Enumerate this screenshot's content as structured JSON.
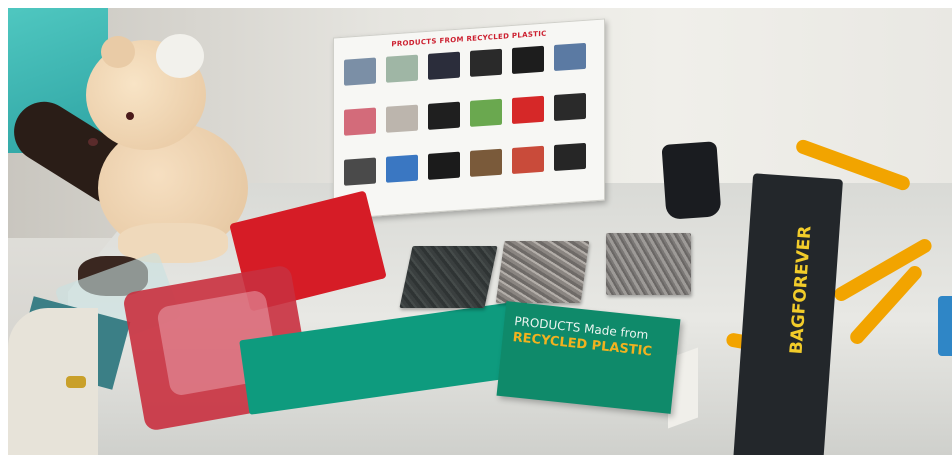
{
  "scene": {
    "subject": "Exhibition table of products made from recycled plastic",
    "poster": {
      "title": "PRODUCTS FROM RECYCLED PLASTIC",
      "items": [
        {
          "label": "",
          "color": "#7b8fa6"
        },
        {
          "label": "",
          "color": "#9fb6a5"
        },
        {
          "label": "",
          "color": "#2b2d3b"
        },
        {
          "label": "",
          "color": "#2a2a2a"
        },
        {
          "label": "",
          "color": "#1d1d1d"
        },
        {
          "label": "",
          "color": "#5b7aa3"
        },
        {
          "label": "",
          "color": "#d36b7a"
        },
        {
          "label": "",
          "color": "#bcb5ad"
        },
        {
          "label": "",
          "color": "#1f1f1f"
        },
        {
          "label": "",
          "color": "#6aa84f"
        },
        {
          "label": "",
          "color": "#d62828"
        },
        {
          "label": "",
          "color": "#2a2a2a"
        },
        {
          "label": "",
          "color": "#4a4a4a"
        },
        {
          "label": "",
          "color": "#3a77c2"
        },
        {
          "label": "",
          "color": "#1b1b1b"
        },
        {
          "label": "",
          "color": "#7a5a3a"
        },
        {
          "label": "",
          "color": "#c94b3a"
        },
        {
          "label": "",
          "color": "#262626"
        }
      ]
    },
    "tent_card": {
      "line1": "PRODUCTS Made from",
      "line2": "RECYCLED PLASTIC"
    },
    "bag_logo": "BAGFOREVER",
    "colors": {
      "tent_card_green": "#0f8a6a",
      "tent_card_accent": "#f2b21f",
      "cloth_red": "#d61c26",
      "cloth_green": "#0e9b7e",
      "strap_yellow": "#f2a400",
      "bag_black": "#23272b"
    }
  }
}
